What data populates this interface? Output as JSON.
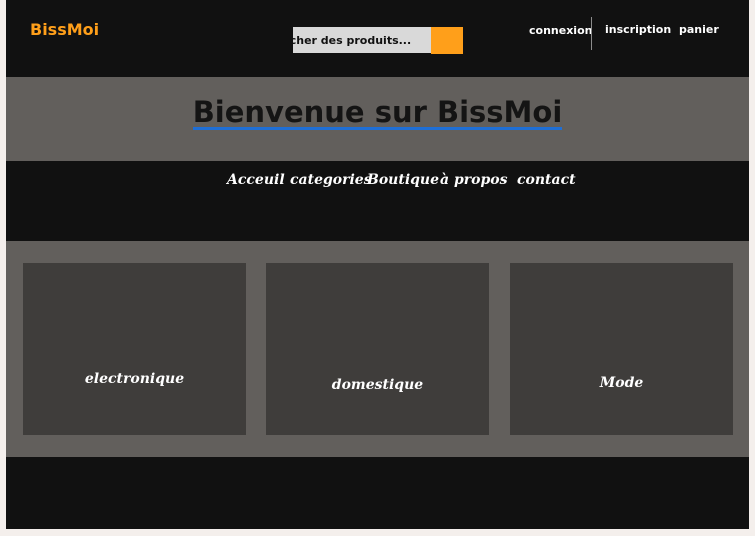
{
  "header": {
    "brand": "BissMoi",
    "search": {
      "placeholder": "hercher des produits..."
    },
    "links": {
      "login": "connexion",
      "signup": "inscription",
      "cart": "panier"
    }
  },
  "banner": {
    "title": "Bienvenue sur BissMoi"
  },
  "nav": {
    "items": [
      "Acceuil",
      "categories",
      "Boutique",
      "à propos",
      "contact"
    ]
  },
  "categories": {
    "items": [
      "electronique",
      "domestique",
      "Mode"
    ]
  },
  "colors": {
    "accent": "#ff9f1a",
    "page_background": "#111111",
    "section_background": "#625f5c",
    "card_background": "#3f3d3b",
    "title_underline": "#1f6fd6"
  }
}
